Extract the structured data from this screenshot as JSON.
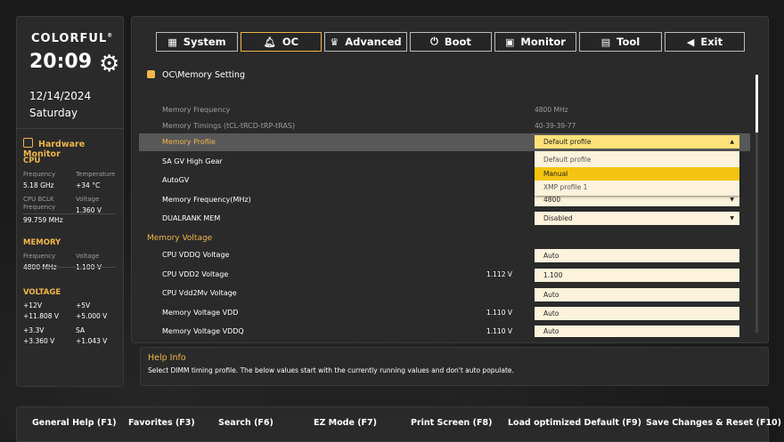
{
  "brand": "COLORFUL",
  "brand_mark": "®",
  "clock": {
    "time": "20:09",
    "date": "12/14/2024",
    "day": "Saturday"
  },
  "hardware_monitor": {
    "title": "Hardware Monitor",
    "cpu": {
      "heading": "CPU",
      "frequency_label": "Frequency",
      "frequency": "5.18 GHz",
      "temperature_label": "Temperature",
      "temperature": "+34 °C",
      "bclk_label_1": "CPU BCLK",
      "bclk_label_2": "Frequency",
      "bclk": "99.759 MHz",
      "voltage_label": "Voltage",
      "voltage": "1.360 V"
    },
    "memory": {
      "heading": "MEMORY",
      "frequency_label": "Frequency",
      "frequency": "4800 MHz",
      "voltage_label": "Voltage",
      "voltage": "1.100 V"
    },
    "voltage": {
      "heading": "VOLTAGE",
      "v12_label": "+12V",
      "v12": "+11.808 V",
      "v5_label": "+5V",
      "v5": "+5.000 V",
      "v33_label": "+3.3V",
      "v33": "+3.360 V",
      "sa_label": "SA",
      "sa": "+1.043 V"
    }
  },
  "tabs": [
    {
      "label": "System",
      "icon": "grid-icon"
    },
    {
      "label": "OC",
      "icon": "rocket-icon"
    },
    {
      "label": "Advanced",
      "icon": "crown-icon"
    },
    {
      "label": "Boot",
      "icon": "power-icon"
    },
    {
      "label": "Monitor",
      "icon": "monitor-icon"
    },
    {
      "label": "Tool",
      "icon": "toolbox-icon"
    },
    {
      "label": "Exit",
      "icon": "back-arrow-icon"
    }
  ],
  "active_tab": "OC",
  "breadcrumb": "OC\\Memory Setting",
  "rows": {
    "mem_freq_label": "Memory Frequency",
    "mem_freq_value": "4800 MHz",
    "mem_timings_label": "Memory Timings (tCL-tRCD-tRP-tRAS)",
    "mem_timings_value": "40-39-39-77",
    "mem_profile_label": "Memory Profile",
    "mem_profile_value": "Default profile",
    "sagv_label": "SA GV High Gear",
    "autogv_label": "AutoGV",
    "mem_freq_mhz_label": "Memory Frequency(MHz)",
    "mem_freq_mhz_value": "4800",
    "dualrank_label": "DUALRANK MEM",
    "dualrank_value": "Disabled"
  },
  "dropdown_options": [
    "Default profile",
    "Manual",
    "XMP profile 1"
  ],
  "dropdown_highlighted": "Manual",
  "memory_voltage": {
    "heading": "Memory Voltage",
    "vddq_label": "CPU VDDQ Voltage",
    "vddq_value": "Auto",
    "vdd2_label": "CPU VDD2 Voltage",
    "vdd2_current": "1.112 V",
    "vdd2_value": "1.100",
    "vdd2mv_label": "CPU Vdd2Mv Voltage",
    "vdd2mv_value": "Auto",
    "mem_vdd_label": "Memory Voltage VDD",
    "mem_vdd_current": "1.110 V",
    "mem_vdd_value": "Auto",
    "mem_vddq_label": "Memory Voltage VDDQ",
    "mem_vddq_current": "1.110 V",
    "mem_vddq_value": "Auto"
  },
  "help": {
    "title": "Help Info",
    "text": "Select DIMM timing profile. The below values start with the currently running values and don't auto populate."
  },
  "footer": [
    "General Help (F1)",
    "Favorites (F3)",
    "Search (F6)",
    "EZ Mode (F7)",
    "Print Screen (F8)",
    "Load optimized Default (F9)",
    "Save Changes & Reset (F10)"
  ],
  "colors": {
    "accent": "#f0b64a",
    "panel": "#2a2a2a",
    "field": "#fdf3dc",
    "selected": "#f5c412"
  }
}
